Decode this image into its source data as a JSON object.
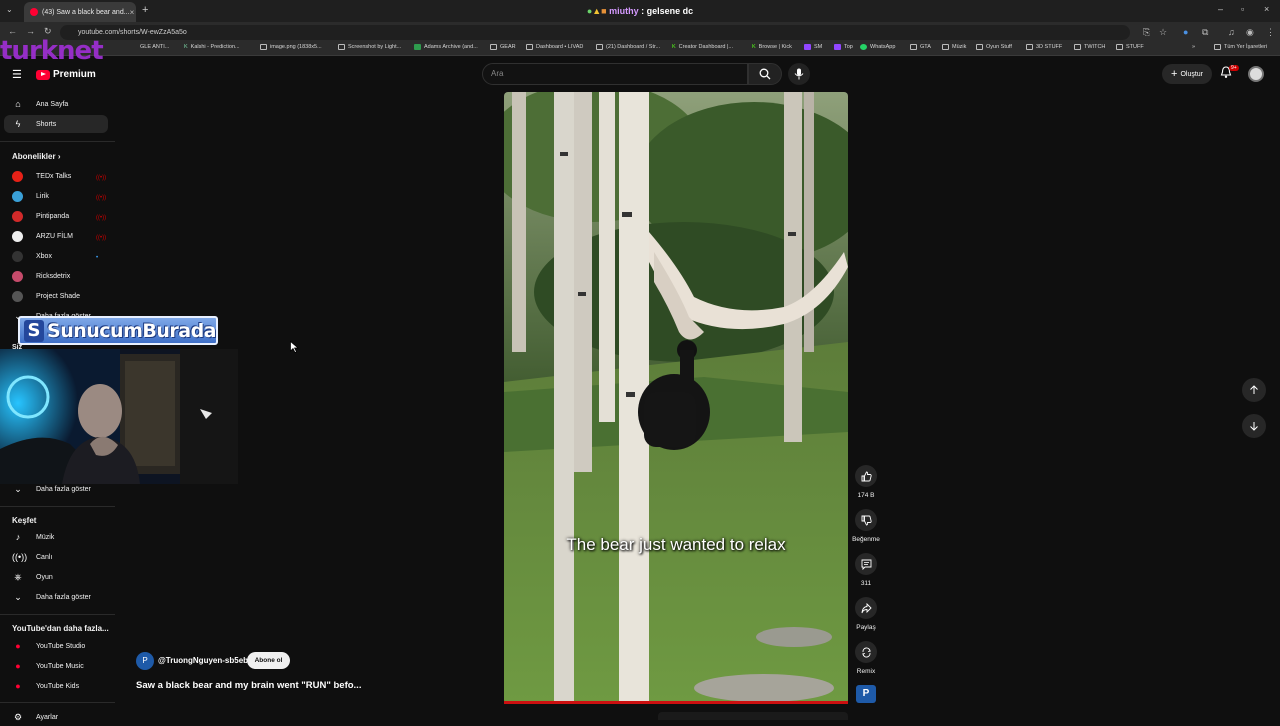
{
  "browser": {
    "tab_title": "(43) Saw a black bear and...",
    "stream_user": "miuthy",
    "stream_text": ": gelsene dc",
    "url": "youtube.com/shorts/W-ewZzA5a5o",
    "all_bookmarks": "Tüm Yer İşaretleri",
    "bookmarks": [
      "GLE ANTI...",
      "Kalshi - Prediction...",
      "image.png (1838x5...",
      "Screenshot by Light...",
      "Adams Archive (and...",
      "GEAR",
      "Dashboard • LIVAD",
      "(21) Dashboard / Str...",
      "Creator Dashboard |...",
      "Browse | Kick",
      "SM",
      "Top",
      "WhatsApp",
      "GTA",
      "Müzik",
      "Oyun Stuff",
      "3D STUFF",
      "TWITCH",
      "STUFF"
    ]
  },
  "overlay": {
    "turknet": "turknet",
    "banner_s": "S",
    "banner_text": "SunucumBurada"
  },
  "header": {
    "logo_text": "Premium",
    "search_placeholder": "Ara",
    "create_label": "Oluştur",
    "notif_count": "9+"
  },
  "sidebar": {
    "home": "Ana Sayfa",
    "shorts": "Shorts",
    "subscriptions_title": "Abonelikler",
    "channels": [
      {
        "name": "TEDx Talks",
        "color": "#e62117"
      },
      {
        "name": "Lirik",
        "color": "#3aa0d8"
      },
      {
        "name": "Pintipanda",
        "color": "#d12a2a"
      },
      {
        "name": "ARZU FİLM",
        "color": "#eeeeee"
      },
      {
        "name": "Xbox",
        "color": "#222222"
      },
      {
        "name": "Ricksdetrix",
        "color": "#c64b6b"
      },
      {
        "name": "Project Shade",
        "color": "#555555"
      }
    ],
    "show_more_1": "Daha fazla göster",
    "you_label": "Siz",
    "show_more_2": "Daha fazla göster",
    "explore_title": "Keşfet",
    "explore": [
      "Müzik",
      "Canlı",
      "Oyun"
    ],
    "show_more_3": "Daha fazla göster",
    "more_from_title": "YouTube'dan daha fazla...",
    "more_from": [
      "YouTube Studio",
      "YouTube Music",
      "YouTube Kids"
    ],
    "settings": "Ayarlar"
  },
  "short": {
    "caption": "The bear just wanted to relax",
    "channel_initial": "P",
    "channel_handle": "@TruongNguyen-sb5eb",
    "subscribe_label": "Abone ol",
    "title": "Saw a black bear and my brain went \"RUN\" befo..."
  },
  "actions": {
    "likes": "174 B",
    "dislike": "Beğenme",
    "comments": "311",
    "share": "Paylaş",
    "remix": "Remix"
  }
}
